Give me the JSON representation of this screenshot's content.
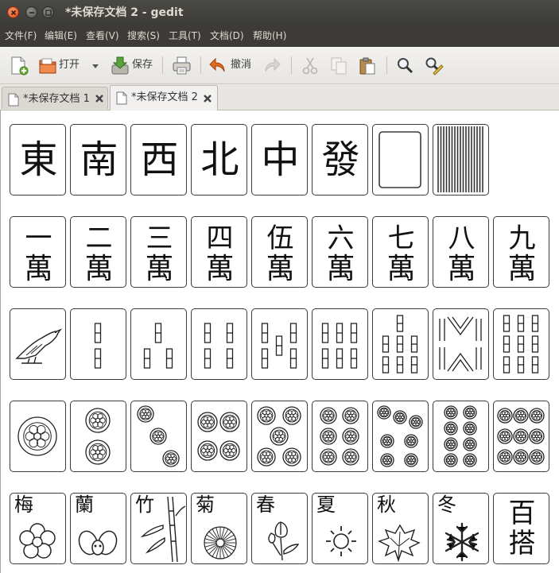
{
  "window": {
    "title": "*未保存文档 2 - gedit"
  },
  "menu": [
    "文件(F)",
    "编辑(E)",
    "查看(V)",
    "搜索(S)",
    "工具(T)",
    "文档(D)",
    "帮助(H)"
  ],
  "toolbar": {
    "open_label": "打开",
    "save_label": "保存",
    "undo_label": "撤消"
  },
  "tabs": [
    {
      "label": "*未保存文档 1",
      "active": false
    },
    {
      "label": "*未保存文档 2",
      "active": true
    }
  ],
  "tiles": {
    "honors": [
      "東",
      "南",
      "西",
      "北",
      "中",
      "發"
    ],
    "characters": [
      {
        "num": "一",
        "suit": "萬"
      },
      {
        "num": "二",
        "suit": "萬"
      },
      {
        "num": "三",
        "suit": "萬"
      },
      {
        "num": "四",
        "suit": "萬"
      },
      {
        "num": "伍",
        "suit": "萬"
      },
      {
        "num": "六",
        "suit": "萬"
      },
      {
        "num": "七",
        "suit": "萬"
      },
      {
        "num": "八",
        "suit": "萬"
      },
      {
        "num": "九",
        "suit": "萬"
      }
    ],
    "bamboo_counts": [
      1,
      2,
      3,
      4,
      5,
      6,
      7,
      8,
      9
    ],
    "circle_counts": [
      1,
      2,
      3,
      4,
      5,
      6,
      7,
      8,
      9
    ],
    "flowers": [
      "梅",
      "蘭",
      "竹",
      "菊",
      "春",
      "夏",
      "秋",
      "冬"
    ],
    "joker": {
      "top": "百",
      "bottom": "搭"
    }
  }
}
